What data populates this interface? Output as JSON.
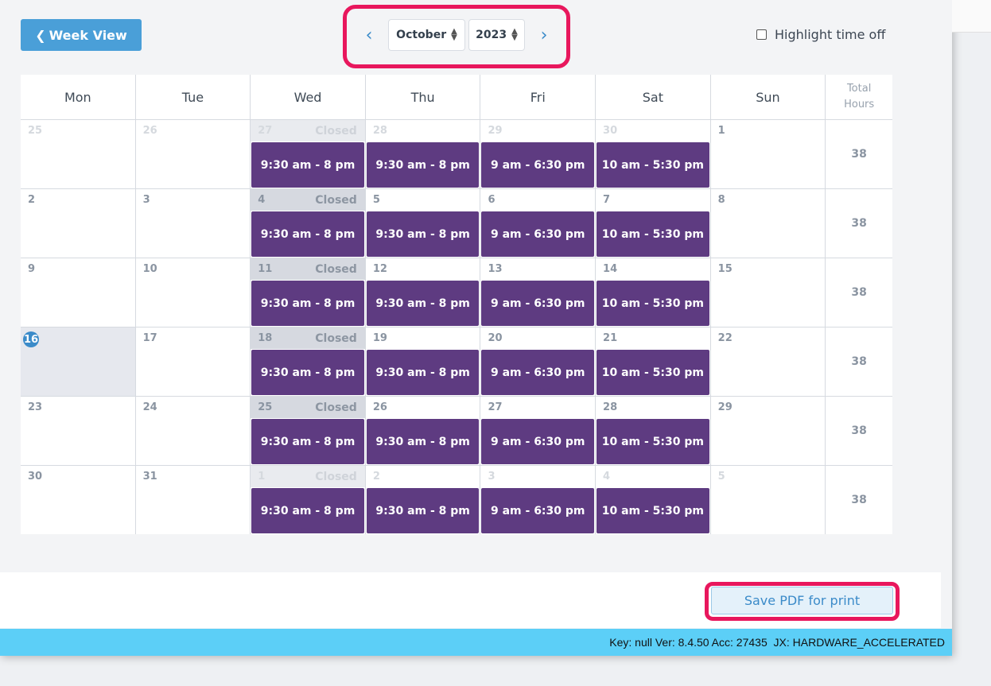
{
  "toolbar": {
    "week_view_label": "Week View",
    "month": "October",
    "year": "2023",
    "highlight_time_off_label": "Highlight time off"
  },
  "calendar": {
    "headers": [
      "Mon",
      "Tue",
      "Wed",
      "Thu",
      "Fri",
      "Sat",
      "Sun"
    ],
    "total_header_line1": "Total",
    "total_header_line2": "Hours",
    "closed_label": "Closed",
    "weeks": [
      {
        "days": [
          "25",
          "26",
          "27",
          "28",
          "29",
          "30",
          "1"
        ],
        "shifts": [
          "",
          "",
          "9:30 am - 8 pm",
          "9:30 am - 8 pm",
          "9 am - 6:30 pm",
          "10 am - 5:30 pm",
          ""
        ],
        "total": "38"
      },
      {
        "days": [
          "2",
          "3",
          "4",
          "5",
          "6",
          "7",
          "8"
        ],
        "shifts": [
          "",
          "",
          "9:30 am - 8 pm",
          "9:30 am - 8 pm",
          "9 am - 6:30 pm",
          "10 am - 5:30 pm",
          ""
        ],
        "total": "38"
      },
      {
        "days": [
          "9",
          "10",
          "11",
          "12",
          "13",
          "14",
          "15"
        ],
        "shifts": [
          "",
          "",
          "9:30 am - 8 pm",
          "9:30 am - 8 pm",
          "9 am - 6:30 pm",
          "10 am - 5:30 pm",
          ""
        ],
        "total": "38"
      },
      {
        "days": [
          "16",
          "17",
          "18",
          "19",
          "20",
          "21",
          "22"
        ],
        "shifts": [
          "",
          "",
          "9:30 am - 8 pm",
          "9:30 am - 8 pm",
          "9 am - 6:30 pm",
          "10 am - 5:30 pm",
          ""
        ],
        "total": "38"
      },
      {
        "days": [
          "23",
          "24",
          "25",
          "26",
          "27",
          "28",
          "29"
        ],
        "shifts": [
          "",
          "",
          "9:30 am - 8 pm",
          "9:30 am - 8 pm",
          "9 am - 6:30 pm",
          "10 am - 5:30 pm",
          ""
        ],
        "total": "38"
      },
      {
        "days": [
          "30",
          "31",
          "1",
          "2",
          "3",
          "4",
          "5"
        ],
        "shifts": [
          "",
          "",
          "9:30 am - 8 pm",
          "9:30 am - 8 pm",
          "9 am - 6:30 pm",
          "10 am - 5:30 pm",
          ""
        ],
        "total": "38"
      }
    ]
  },
  "footer": {
    "save_pdf_label": "Save PDF for print"
  },
  "status_bar": {
    "text": "Key: null Ver: 8.4.50 Acc: 27435  JX: HARDWARE_ACCELERATED"
  },
  "colors": {
    "accent": "#4a9fd8",
    "shift": "#5e3b81",
    "highlight": "#e8175d",
    "status_bar": "#5ccff7"
  }
}
